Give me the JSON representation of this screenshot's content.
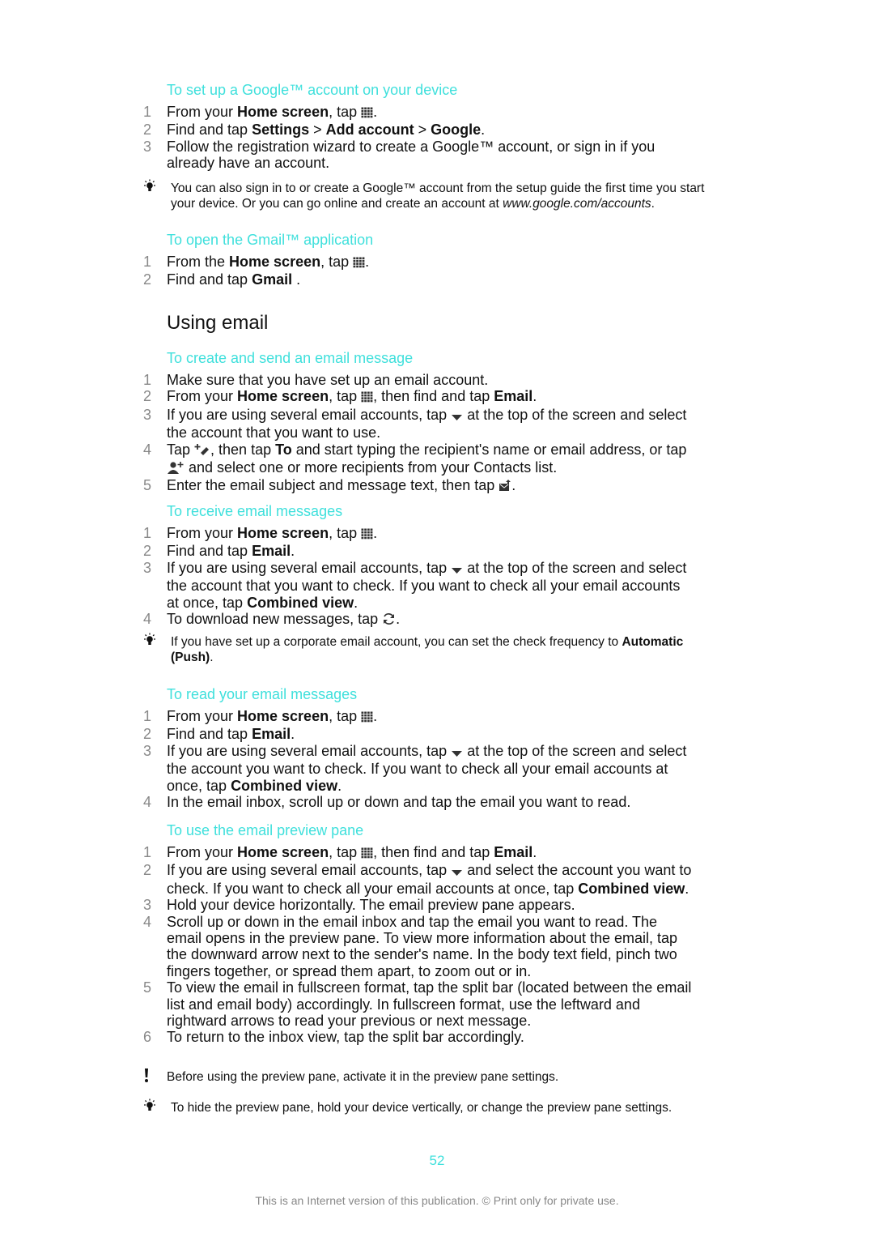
{
  "sections": [
    {
      "heading": "To set up a Google™ account on your device",
      "steps": [
        {
          "n": "1",
          "parts": [
            {
              "t": "From your "
            },
            {
              "b": "Home screen"
            },
            {
              "t": ", tap "
            },
            {
              "i": "apps-grid-icon"
            },
            {
              "t": "."
            }
          ]
        },
        {
          "n": "2",
          "parts": [
            {
              "t": "Find and tap "
            },
            {
              "b": "Settings"
            },
            {
              "t": " > "
            },
            {
              "b": "Add account"
            },
            {
              "t": " > "
            },
            {
              "b": "Google"
            },
            {
              "t": "."
            }
          ]
        },
        {
          "n": "3",
          "parts": [
            {
              "t": "Follow the registration wizard to create a Google™ account, or sign in if you already have an account."
            }
          ]
        }
      ]
    },
    {
      "heading": "To open the Gmail™ application",
      "steps": [
        {
          "n": "1",
          "parts": [
            {
              "t": "From the "
            },
            {
              "b": "Home screen"
            },
            {
              "t": ", tap "
            },
            {
              "i": "apps-grid-icon"
            },
            {
              "t": "."
            }
          ]
        },
        {
          "n": "2",
          "parts": [
            {
              "t": "Find and tap "
            },
            {
              "b": "Gmail"
            },
            {
              "t": " ."
            }
          ]
        }
      ]
    },
    {
      "heading": "To create and send an email message",
      "steps": [
        {
          "n": "1",
          "parts": [
            {
              "t": "Make sure that you have set up an email account."
            }
          ]
        },
        {
          "n": "2",
          "parts": [
            {
              "t": "From your "
            },
            {
              "b": "Home screen"
            },
            {
              "t": ", tap "
            },
            {
              "i": "apps-grid-icon"
            },
            {
              "t": ", then find and tap "
            },
            {
              "b": "Email"
            },
            {
              "t": "."
            }
          ]
        },
        {
          "n": "3",
          "parts": [
            {
              "t": "If you are using several email accounts, tap "
            },
            {
              "i": "dropdown-arrow-icon"
            },
            {
              "t": " at the top of the screen and select the account that you want to use."
            }
          ]
        },
        {
          "n": "4",
          "parts": [
            {
              "t": "Tap "
            },
            {
              "i": "compose-icon"
            },
            {
              "t": ", then tap "
            },
            {
              "b": "To"
            },
            {
              "t": " and start typing the recipient's name or email address, or tap "
            },
            {
              "i": "add-contact-icon"
            },
            {
              "t": " and select one or more recipients from your Contacts list."
            }
          ]
        },
        {
          "n": "5",
          "parts": [
            {
              "t": "Enter the email subject and message text, then tap "
            },
            {
              "i": "send-icon"
            },
            {
              "t": "."
            }
          ]
        }
      ]
    },
    {
      "heading": "To receive email messages",
      "steps": [
        {
          "n": "1",
          "parts": [
            {
              "t": "From your "
            },
            {
              "b": "Home screen"
            },
            {
              "t": ", tap "
            },
            {
              "i": "apps-grid-icon"
            },
            {
              "t": "."
            }
          ]
        },
        {
          "n": "2",
          "parts": [
            {
              "t": "Find and tap "
            },
            {
              "b": "Email"
            },
            {
              "t": "."
            }
          ]
        },
        {
          "n": "3",
          "parts": [
            {
              "t": "If you are using several email accounts, tap "
            },
            {
              "i": "dropdown-arrow-icon"
            },
            {
              "t": " at the top of the screen and select the account that you want to check. If you want to check all your email accounts at once, tap "
            },
            {
              "b": "Combined view"
            },
            {
              "t": "."
            }
          ]
        },
        {
          "n": "4",
          "parts": [
            {
              "t": "To download new messages, tap "
            },
            {
              "i": "refresh-icon"
            },
            {
              "t": "."
            }
          ]
        }
      ]
    },
    {
      "heading": "To read your email messages",
      "steps": [
        {
          "n": "1",
          "parts": [
            {
              "t": "From your "
            },
            {
              "b": "Home screen"
            },
            {
              "t": ", tap "
            },
            {
              "i": "apps-grid-icon"
            },
            {
              "t": "."
            }
          ]
        },
        {
          "n": "2",
          "parts": [
            {
              "t": "Find and tap "
            },
            {
              "b": "Email"
            },
            {
              "t": "."
            }
          ]
        },
        {
          "n": "3",
          "parts": [
            {
              "t": "If you are using several email accounts, tap "
            },
            {
              "i": "dropdown-arrow-icon"
            },
            {
              "t": " at the top of the screen and select the account you want to check. If you want to check all your email accounts at once, tap "
            },
            {
              "b": "Combined view"
            },
            {
              "t": "."
            }
          ]
        },
        {
          "n": "4",
          "parts": [
            {
              "t": "In the email inbox, scroll up or down and tap the email you want to read."
            }
          ]
        }
      ]
    },
    {
      "heading": "To use the email preview pane",
      "steps": [
        {
          "n": "1",
          "parts": [
            {
              "t": "From your "
            },
            {
              "b": "Home screen"
            },
            {
              "t": ", tap "
            },
            {
              "i": "apps-grid-icon"
            },
            {
              "t": ", then find and tap "
            },
            {
              "b": "Email"
            },
            {
              "t": "."
            }
          ]
        },
        {
          "n": "2",
          "parts": [
            {
              "t": "If you are using several email accounts, tap "
            },
            {
              "i": "dropdown-arrow-icon"
            },
            {
              "t": " and select the account you want to check. If you want to check all your email accounts at once, tap "
            },
            {
              "b": "Combined view"
            },
            {
              "t": "."
            }
          ]
        },
        {
          "n": "3",
          "parts": [
            {
              "t": "Hold your device horizontally. The email preview pane appears."
            }
          ]
        },
        {
          "n": "4",
          "parts": [
            {
              "t": "Scroll up or down in the email inbox and tap the email you want to read. The email opens in the preview pane. To view more information about the email, tap the downward arrow next to the sender's name. In the body text field, pinch two fingers together, or spread them apart, to zoom out or in."
            }
          ]
        },
        {
          "n": "5",
          "parts": [
            {
              "t": "To view the email in fullscreen format, tap the split bar (located between the email list and email body) accordingly. In fullscreen format, use the leftward and rightward arrows to read your previous or next message."
            }
          ]
        },
        {
          "n": "6",
          "parts": [
            {
              "t": "To return to the inbox view, tap the split bar accordingly."
            }
          ]
        }
      ]
    }
  ],
  "subheading": "Using email",
  "notes": [
    {
      "type": "tip",
      "icon": "lightbulb-icon",
      "parts": [
        {
          "t": "You can also sign in to or create a Google™ account from the setup guide the first time you start your device. Or you can go online and create an account at "
        },
        {
          "e": "www.google.com/accounts"
        },
        {
          "t": "."
        }
      ]
    },
    {
      "type": "tip",
      "icon": "lightbulb-icon",
      "parts": [
        {
          "t": "If you have set up a corporate email account, you can set the check frequency to "
        },
        {
          "b": "Automatic (Push)"
        },
        {
          "t": "."
        }
      ]
    },
    {
      "type": "note",
      "icon": "exclamation-icon",
      "parts": [
        {
          "t": "Before using the preview pane, activate it in the preview pane settings."
        }
      ]
    },
    {
      "type": "tip",
      "icon": "lightbulb-icon",
      "parts": [
        {
          "t": "To hide the preview pane, hold your device vertically, or change the preview pane settings."
        }
      ]
    }
  ],
  "page_number": "52",
  "footer": "This is an Internet version of this publication. © Print only for private use.",
  "colors": {
    "heading": "#3fe0dc",
    "text": "#111111",
    "step_number": "#888888"
  }
}
